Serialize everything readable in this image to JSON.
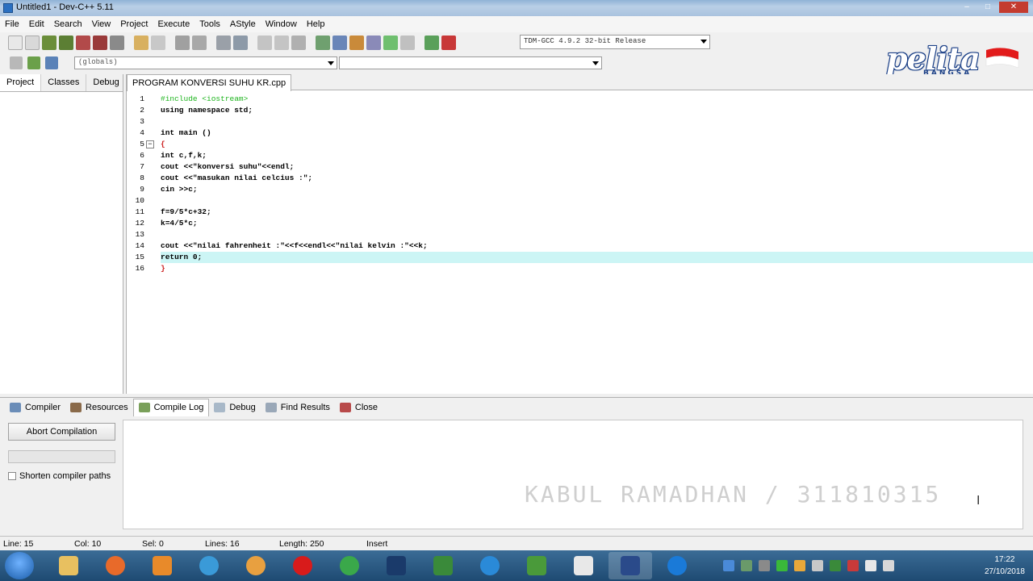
{
  "window": {
    "title": "Untitled1 - Dev-C++ 5.11"
  },
  "menu": [
    "File",
    "Edit",
    "Search",
    "View",
    "Project",
    "Execute",
    "Tools",
    "AStyle",
    "Window",
    "Help"
  ],
  "toolbar": {
    "compiler": "TDM-GCC 4.9.2 32-bit Release",
    "scope": "(globals)"
  },
  "logo": {
    "text": "pelita",
    "sub": "BANGSA"
  },
  "left_panel": {
    "tabs": [
      "Project",
      "Classes",
      "Debug"
    ]
  },
  "editor": {
    "tab_title": "PROGRAM KONVERSI SUHU KR.cpp",
    "lines": [
      {
        "n": "1",
        "text": "#include <iostream>"
      },
      {
        "n": "2",
        "text": "using namespace std;"
      },
      {
        "n": "3",
        "text": ""
      },
      {
        "n": "4",
        "text": "int main ()"
      },
      {
        "n": "5",
        "text": "{"
      },
      {
        "n": "6",
        "text": "int c,f,k;"
      },
      {
        "n": "7",
        "text": "cout <<\"konversi suhu\"<<endl;"
      },
      {
        "n": "8",
        "text": "cout <<\"masukan nilai celcius :\";"
      },
      {
        "n": "9",
        "text": "cin >>c;"
      },
      {
        "n": "10",
        "text": ""
      },
      {
        "n": "11",
        "text": "f=9/5*c+32;"
      },
      {
        "n": "12",
        "text": "k=4/5*c;"
      },
      {
        "n": "13",
        "text": ""
      },
      {
        "n": "14",
        "text": "cout <<\"nilai fahrenheit :\"<<f<<endl<<\"nilai kelvin :\"<<k;"
      },
      {
        "n": "15",
        "text": "return 0;"
      },
      {
        "n": "16",
        "text": "}"
      }
    ]
  },
  "bottom_tabs": [
    "Compiler",
    "Resources",
    "Compile Log",
    "Debug",
    "Find Results",
    "Close"
  ],
  "compile_panel": {
    "abort_label": "Abort Compilation",
    "shorten_label": "Shorten compiler paths",
    "watermark": "KABUL RAMADHAN / 311810315"
  },
  "status": {
    "line": "Line:  15",
    "col": "Col:  10",
    "sel": "Sel:  0",
    "lines": "Lines:  16",
    "length": "Length:  250",
    "mode": "Insert"
  },
  "taskbar": {
    "time": "17:22",
    "date": "27/10/2018"
  },
  "colors": {
    "current_line": "#ccf5f5",
    "preprocessor": "#1db41d",
    "string": "#1d1ddd",
    "taskbar": "#1e4a72"
  }
}
